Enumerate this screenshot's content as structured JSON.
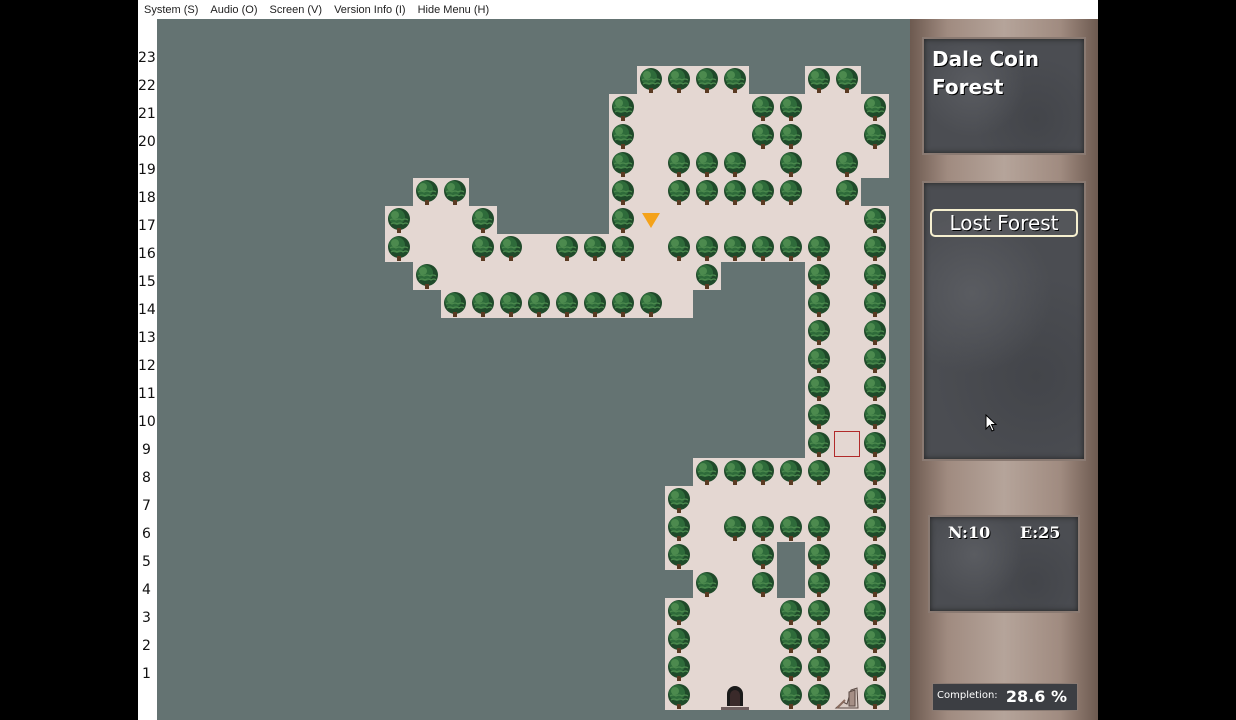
{
  "menu": {
    "items": [
      "System (S)",
      "Audio (O)",
      "Screen (V)",
      "Version Info (I)",
      "Hide Menu (H)"
    ]
  },
  "map": {
    "row_labels": [
      "23",
      "22",
      "21",
      "20",
      "19",
      "18",
      "17",
      "16",
      "15",
      "14",
      "13",
      "12",
      "11",
      "10",
      "9",
      "8",
      "7",
      "6",
      "5",
      "4",
      "3",
      "2",
      "1"
    ],
    "colors": {
      "void": "#647372",
      "floor": "#e4d7d2",
      "tree_dark": "#1f4a2a",
      "tree_mid": "#2e6b3a",
      "tree_light": "#4c8a4e",
      "player_marker": "#f4a21a",
      "cursor_box": "#b12a2a"
    },
    "icons": [
      "tree-icon",
      "player-marker-icon",
      "door-icon",
      "stairs-icon",
      "cursor-box"
    ]
  },
  "panel": {
    "area_name": "Dale Coin Forest",
    "floor_name": "Lost Forest",
    "coords": {
      "n_label": "N:",
      "n_value": "10",
      "e_label": "E:",
      "e_value": "25"
    },
    "completion": {
      "label": "Completion:",
      "value": "28.6 %"
    }
  }
}
